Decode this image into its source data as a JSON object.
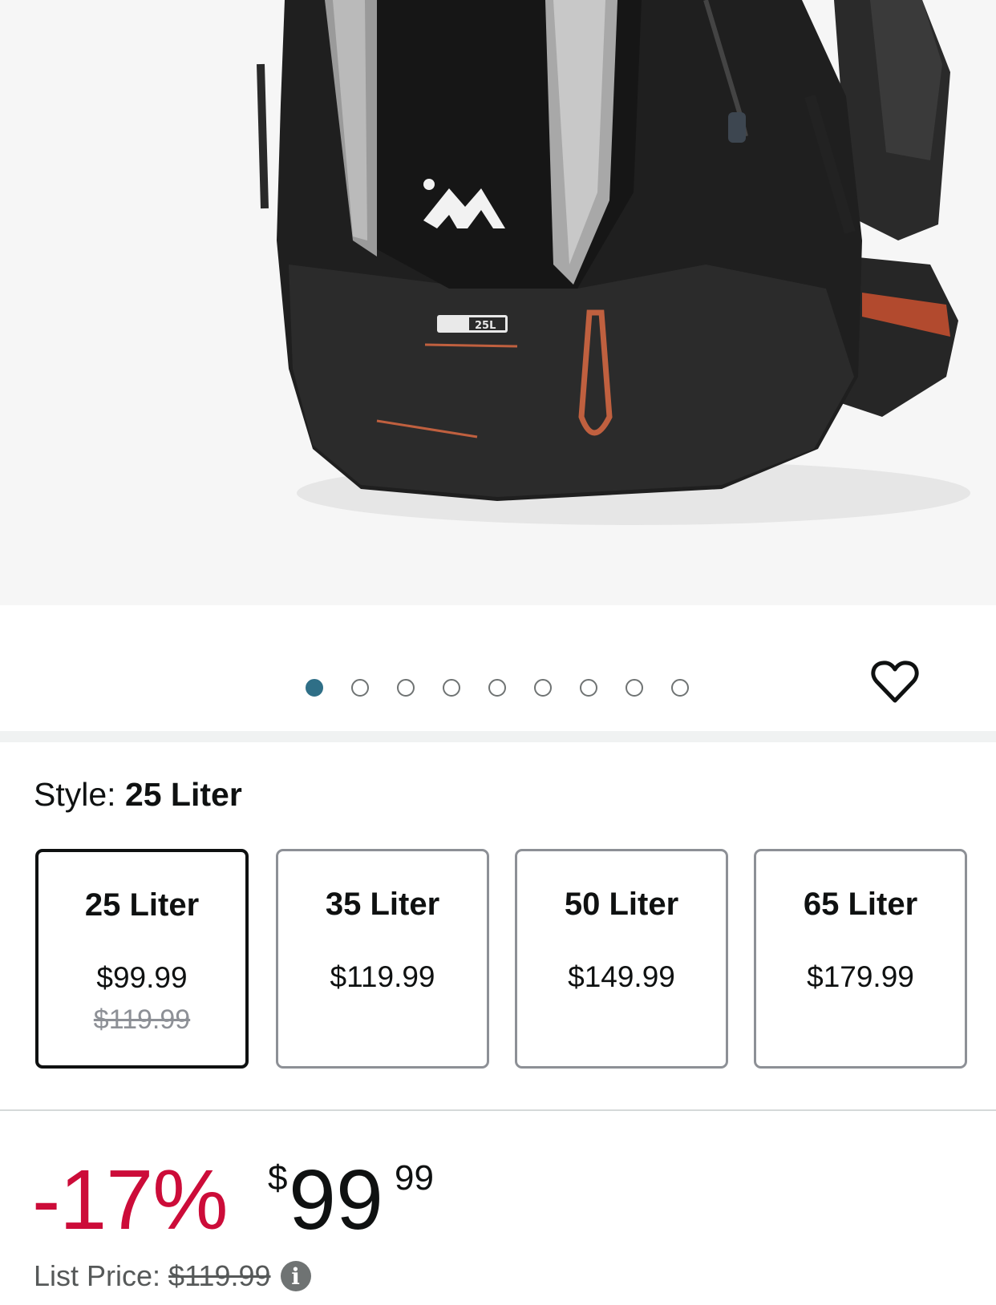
{
  "product_image": {
    "alt": "backpack-photo",
    "badge_text": "25L"
  },
  "carousel": {
    "dot_count": 9,
    "active_index": 0,
    "active_color": "#2f6f87"
  },
  "wishlist_icon": "heart-outline-icon",
  "style": {
    "label": "Style: ",
    "selected": "25 Liter"
  },
  "swatches": [
    {
      "name": "25 Liter",
      "price": "$99.99",
      "was": "$119.99",
      "selected": true
    },
    {
      "name": "35 Liter",
      "price": "$119.99",
      "was": "",
      "selected": false
    },
    {
      "name": "50 Liter",
      "price": "$149.99",
      "was": "",
      "selected": false
    },
    {
      "name": "65 Liter",
      "price": "$179.99",
      "was": "",
      "selected": false
    }
  ],
  "pricing": {
    "discount": "-17%",
    "currency": "$",
    "whole": "99",
    "fraction": "99",
    "list_label": "List Price:",
    "list_price": "$119.99",
    "discount_color": "#cc0c39"
  }
}
